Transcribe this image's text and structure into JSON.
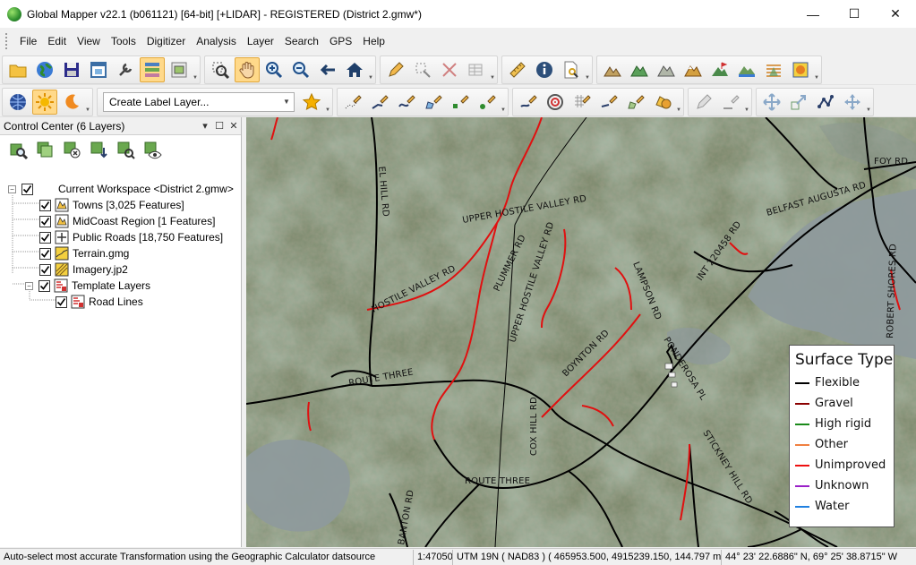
{
  "window": {
    "title": "Global Mapper v22.1 (b061121) [64-bit] [+LIDAR] - REGISTERED (District 2.gmw*)",
    "minimize": "—",
    "maximize": "☐",
    "close": "✕"
  },
  "menu": [
    "File",
    "Edit",
    "View",
    "Tools",
    "Digitizer",
    "Analysis",
    "Layer",
    "Search",
    "GPS",
    "Help"
  ],
  "toolbar": {
    "label_layer_combo": "Create Label Layer..."
  },
  "control_center": {
    "title": "Control Center (6 Layers)",
    "layers": [
      {
        "label": "Current Workspace <District 2.gmw>",
        "checked": true
      },
      {
        "label": "Towns [3,025 Features]",
        "checked": true
      },
      {
        "label": "MidCoast Region [1 Features]",
        "checked": true
      },
      {
        "label": "Public Roads [18,750 Features]",
        "checked": true
      },
      {
        "label": "Terrain.gmg",
        "checked": true
      },
      {
        "label": "Imagery.jp2",
        "checked": true
      },
      {
        "label": "Template Layers",
        "checked": true
      },
      {
        "label": "Road Lines",
        "checked": true
      }
    ]
  },
  "map": {
    "road_labels": [
      "EL HILL RD",
      "UPPER HOSTILE VALLEY RD",
      "HOSTILE VALLEY RD",
      "PLUMMER RD",
      "UPPER HOSTILE VALLEY RD",
      "LAMPSON RD",
      "INT 220458 RD",
      "BELFAST AUGUSTA RD",
      "FOY RD",
      "ROBERT SHORES RD",
      "ROUTE THREE",
      "BOYNTON RD",
      "PONDEROSA PL",
      "COX HILL RD",
      "STICKNEY HILL RD",
      "ROUTE THREE",
      "BANTON RD"
    ],
    "legend": {
      "title": "Surface Type",
      "items": [
        {
          "label": "Flexible",
          "color": "#000000"
        },
        {
          "label": "Gravel",
          "color": "#8b0000"
        },
        {
          "label": "High rigid",
          "color": "#1a8a1a"
        },
        {
          "label": "Other",
          "color": "#f08040"
        },
        {
          "label": "Unimproved",
          "color": "#ee1010"
        },
        {
          "label": "Unknown",
          "color": "#9a20c8"
        },
        {
          "label": "Water",
          "color": "#2080e0"
        }
      ]
    }
  },
  "status": {
    "message": "Auto-select most accurate Transformation using the Geographic Calculator datsource",
    "scale": "1:47050",
    "projection": "UTM 19N ( NAD83 ) ( 465953.500, 4915239.150, 144.797 m )",
    "latlon": "44° 23' 22.6886\" N, 69° 25' 38.8715\" W"
  }
}
